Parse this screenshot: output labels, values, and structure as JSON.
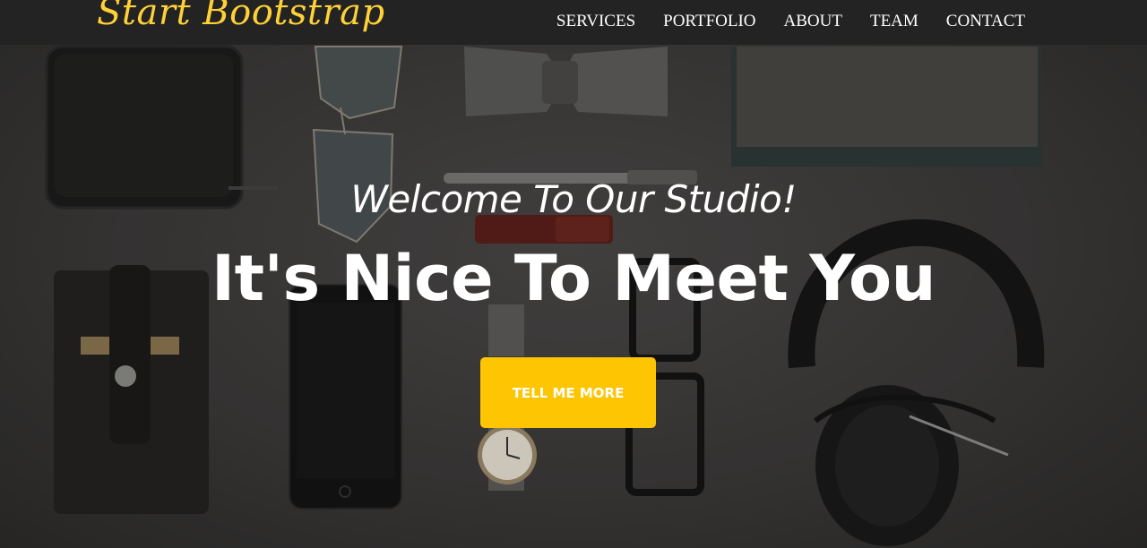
{
  "navbar": {
    "brand": "Start Bootstrap",
    "links": [
      "SERVICES",
      "PORTFOLIO",
      "ABOUT",
      "TEAM",
      "CONTACT"
    ]
  },
  "hero": {
    "subheading": "Welcome To Our Studio!",
    "heading": "It's Nice To Meet You",
    "button_label": "TELL ME MORE"
  },
  "colors": {
    "navbar_bg": "#232323",
    "brand": "#fed136",
    "button": "#fec503",
    "text": "#ffffff"
  },
  "background_image_icons": [
    "wallet-icon",
    "sunglasses-icon",
    "bow-tie-icon",
    "notebook-icon",
    "pen-icon",
    "lipstick-icon",
    "phone-sleeve-icon",
    "smartphone-icon",
    "wristwatch-icon",
    "eyeglasses-icon",
    "headphones-icon"
  ]
}
